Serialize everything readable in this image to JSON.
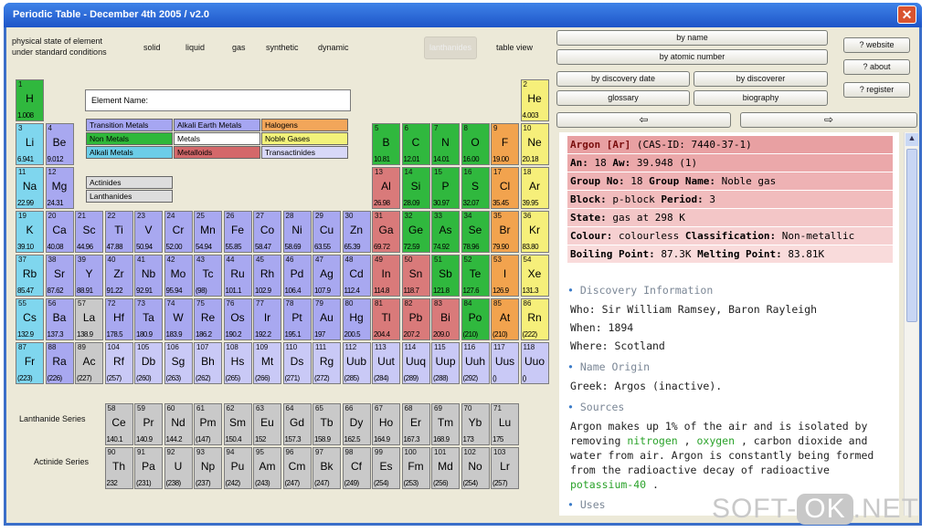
{
  "window": {
    "title": "Periodic Table - December 4th 2005 / v2.0",
    "close_glyph": "✕"
  },
  "toolbar": {
    "physical_state_label": "physical state of element\nunder standard conditions",
    "states": [
      "solid",
      "liquid",
      "gas",
      "synthetic",
      "dynamic"
    ],
    "disabled_button": "lanthanides",
    "table_view": "table view"
  },
  "sort_buttons": {
    "by_name": "by name",
    "by_atomic_number": "by atomic number",
    "by_discovery_date": "by discovery date",
    "by_discoverer": "by discoverer",
    "glossary": "glossary",
    "biography": "biography",
    "prev_arrow": "⇦",
    "next_arrow": "⇨",
    "website": "? website",
    "about": "? about",
    "register": "? register"
  },
  "element_name_label": "Element Name:",
  "legend": {
    "items": [
      "Transition Metals",
      "Alkali Earth Metals",
      "Halogens",
      "Non Metals",
      "Metals",
      "Noble Gases",
      "Alkali Metals",
      "Metalloids",
      "Transactinides"
    ],
    "colors": [
      "#a6a6f2",
      "#a6a6f2",
      "#f2a65a",
      "#2fb83a",
      "#ffffff",
      "#f2f27a",
      "#6ccde8",
      "#d4686a",
      "#d8d8f8"
    ],
    "actinides": "Actinides",
    "lanthanides": "Lanthanides"
  },
  "series_labels": {
    "lanthanide": "Lanthanide Series",
    "actinide": "Actinide Series"
  },
  "colors": {
    "alkali": "#7fd6ee",
    "alkaline": "#a8a8f0",
    "transition": "#a8a8f0",
    "nonmetal": "#30b83e",
    "halogen": "#f2a34e",
    "noble": "#f6ef7a",
    "metalloid": "#d97a7a",
    "metal": "#c9c9c9",
    "lanact": "#c9c9c9",
    "trans": "#c9c9f6",
    "hydrogen": "#30b83e"
  },
  "elements": [
    {
      "n": "1",
      "s": "H",
      "w": "1.008",
      "c": "hydrogen",
      "col": 1,
      "row": 1
    },
    {
      "n": "2",
      "s": "He",
      "w": "4.003",
      "c": "noble",
      "col": 18,
      "row": 1
    },
    {
      "n": "3",
      "s": "Li",
      "w": "6.941",
      "c": "alkali",
      "col": 1,
      "row": 2
    },
    {
      "n": "4",
      "s": "Be",
      "w": "9.012",
      "c": "alkaline",
      "col": 2,
      "row": 2
    },
    {
      "n": "5",
      "s": "B",
      "w": "10.81",
      "c": "nonmetal",
      "col": 13,
      "row": 2
    },
    {
      "n": "6",
      "s": "C",
      "w": "12.01",
      "c": "nonmetal",
      "col": 14,
      "row": 2
    },
    {
      "n": "7",
      "s": "N",
      "w": "14.01",
      "c": "nonmetal",
      "col": 15,
      "row": 2
    },
    {
      "n": "8",
      "s": "O",
      "w": "16.00",
      "c": "nonmetal",
      "col": 16,
      "row": 2
    },
    {
      "n": "9",
      "s": "F",
      "w": "19.00",
      "c": "halogen",
      "col": 17,
      "row": 2
    },
    {
      "n": "10",
      "s": "Ne",
      "w": "20.18",
      "c": "noble",
      "col": 18,
      "row": 2
    },
    {
      "n": "11",
      "s": "Na",
      "w": "22.99",
      "c": "alkali",
      "col": 1,
      "row": 3
    },
    {
      "n": "12",
      "s": "Mg",
      "w": "24.31",
      "c": "alkaline",
      "col": 2,
      "row": 3
    },
    {
      "n": "13",
      "s": "Al",
      "w": "26.98",
      "c": "metalloid",
      "col": 13,
      "row": 3
    },
    {
      "n": "14",
      "s": "Si",
      "w": "28.09",
      "c": "nonmetal",
      "col": 14,
      "row": 3
    },
    {
      "n": "15",
      "s": "P",
      "w": "30.97",
      "c": "nonmetal",
      "col": 15,
      "row": 3
    },
    {
      "n": "16",
      "s": "S",
      "w": "32.07",
      "c": "nonmetal",
      "col": 16,
      "row": 3
    },
    {
      "n": "17",
      "s": "Cl",
      "w": "35.45",
      "c": "halogen",
      "col": 17,
      "row": 3
    },
    {
      "n": "18",
      "s": "Ar",
      "w": "39.95",
      "c": "noble",
      "col": 18,
      "row": 3
    },
    {
      "n": "19",
      "s": "K",
      "w": "39.10",
      "c": "alkali",
      "col": 1,
      "row": 4
    },
    {
      "n": "20",
      "s": "Ca",
      "w": "40.08",
      "c": "alkaline",
      "col": 2,
      "row": 4
    },
    {
      "n": "21",
      "s": "Sc",
      "w": "44.96",
      "c": "transition",
      "col": 3,
      "row": 4
    },
    {
      "n": "22",
      "s": "Ti",
      "w": "47.88",
      "c": "transition",
      "col": 4,
      "row": 4
    },
    {
      "n": "23",
      "s": "V",
      "w": "50.94",
      "c": "transition",
      "col": 5,
      "row": 4
    },
    {
      "n": "24",
      "s": "Cr",
      "w": "52.00",
      "c": "transition",
      "col": 6,
      "row": 4
    },
    {
      "n": "25",
      "s": "Mn",
      "w": "54.94",
      "c": "transition",
      "col": 7,
      "row": 4
    },
    {
      "n": "26",
      "s": "Fe",
      "w": "55.85",
      "c": "transition",
      "col": 8,
      "row": 4
    },
    {
      "n": "27",
      "s": "Co",
      "w": "58.47",
      "c": "transition",
      "col": 9,
      "row": 4
    },
    {
      "n": "28",
      "s": "Ni",
      "w": "58.69",
      "c": "transition",
      "col": 10,
      "row": 4
    },
    {
      "n": "29",
      "s": "Cu",
      "w": "63.55",
      "c": "transition",
      "col": 11,
      "row": 4
    },
    {
      "n": "30",
      "s": "Zn",
      "w": "65.39",
      "c": "transition",
      "col": 12,
      "row": 4
    },
    {
      "n": "31",
      "s": "Ga",
      "w": "69.72",
      "c": "metalloid",
      "col": 13,
      "row": 4
    },
    {
      "n": "32",
      "s": "Ge",
      "w": "72.59",
      "c": "nonmetal",
      "col": 14,
      "row": 4
    },
    {
      "n": "33",
      "s": "As",
      "w": "74.92",
      "c": "nonmetal",
      "col": 15,
      "row": 4
    },
    {
      "n": "34",
      "s": "Se",
      "w": "78.96",
      "c": "nonmetal",
      "col": 16,
      "row": 4
    },
    {
      "n": "35",
      "s": "Br",
      "w": "79.90",
      "c": "halogen",
      "col": 17,
      "row": 4
    },
    {
      "n": "36",
      "s": "Kr",
      "w": "83.80",
      "c": "noble",
      "col": 18,
      "row": 4
    },
    {
      "n": "37",
      "s": "Rb",
      "w": "85.47",
      "c": "alkali",
      "col": 1,
      "row": 5
    },
    {
      "n": "38",
      "s": "Sr",
      "w": "87.62",
      "c": "alkaline",
      "col": 2,
      "row": 5
    },
    {
      "n": "39",
      "s": "Y",
      "w": "88.91",
      "c": "transition",
      "col": 3,
      "row": 5
    },
    {
      "n": "40",
      "s": "Zr",
      "w": "91.22",
      "c": "transition",
      "col": 4,
      "row": 5
    },
    {
      "n": "41",
      "s": "Nb",
      "w": "92.91",
      "c": "transition",
      "col": 5,
      "row": 5
    },
    {
      "n": "42",
      "s": "Mo",
      "w": "95.94",
      "c": "transition",
      "col": 6,
      "row": 5
    },
    {
      "n": "43",
      "s": "Tc",
      "w": "(98)",
      "c": "transition",
      "col": 7,
      "row": 5
    },
    {
      "n": "44",
      "s": "Ru",
      "w": "101.1",
      "c": "transition",
      "col": 8,
      "row": 5
    },
    {
      "n": "45",
      "s": "Rh",
      "w": "102.9",
      "c": "transition",
      "col": 9,
      "row": 5
    },
    {
      "n": "46",
      "s": "Pd",
      "w": "106.4",
      "c": "transition",
      "col": 10,
      "row": 5
    },
    {
      "n": "47",
      "s": "Ag",
      "w": "107.9",
      "c": "transition",
      "col": 11,
      "row": 5
    },
    {
      "n": "48",
      "s": "Cd",
      "w": "112.4",
      "c": "transition",
      "col": 12,
      "row": 5
    },
    {
      "n": "49",
      "s": "In",
      "w": "114.8",
      "c": "metalloid",
      "col": 13,
      "row": 5
    },
    {
      "n": "50",
      "s": "Sn",
      "w": "118.7",
      "c": "metalloid",
      "col": 14,
      "row": 5
    },
    {
      "n": "51",
      "s": "Sb",
      "w": "121.8",
      "c": "nonmetal",
      "col": 15,
      "row": 5
    },
    {
      "n": "52",
      "s": "Te",
      "w": "127.6",
      "c": "nonmetal",
      "col": 16,
      "row": 5
    },
    {
      "n": "53",
      "s": "I",
      "w": "126.9",
      "c": "halogen",
      "col": 17,
      "row": 5
    },
    {
      "n": "54",
      "s": "Xe",
      "w": "131.3",
      "c": "noble",
      "col": 18,
      "row": 5
    },
    {
      "n": "55",
      "s": "Cs",
      "w": "132.9",
      "c": "alkali",
      "col": 1,
      "row": 6
    },
    {
      "n": "56",
      "s": "Ba",
      "w": "137.3",
      "c": "alkaline",
      "col": 2,
      "row": 6
    },
    {
      "n": "57",
      "s": "La",
      "w": "138.9",
      "c": "lanact",
      "col": 3,
      "row": 6
    },
    {
      "n": "72",
      "s": "Hf",
      "w": "178.5",
      "c": "transition",
      "col": 4,
      "row": 6
    },
    {
      "n": "73",
      "s": "Ta",
      "w": "180.9",
      "c": "transition",
      "col": 5,
      "row": 6
    },
    {
      "n": "74",
      "s": "W",
      "w": "183.9",
      "c": "transition",
      "col": 6,
      "row": 6
    },
    {
      "n": "75",
      "s": "Re",
      "w": "186.2",
      "c": "transition",
      "col": 7,
      "row": 6
    },
    {
      "n": "76",
      "s": "Os",
      "w": "190.2",
      "c": "transition",
      "col": 8,
      "row": 6
    },
    {
      "n": "77",
      "s": "Ir",
      "w": "192.2",
      "c": "transition",
      "col": 9,
      "row": 6
    },
    {
      "n": "78",
      "s": "Pt",
      "w": "195.1",
      "c": "transition",
      "col": 10,
      "row": 6
    },
    {
      "n": "79",
      "s": "Au",
      "w": "197",
      "c": "transition",
      "col": 11,
      "row": 6
    },
    {
      "n": "80",
      "s": "Hg",
      "w": "200.5",
      "c": "transition",
      "col": 12,
      "row": 6
    },
    {
      "n": "81",
      "s": "Tl",
      "w": "204.4",
      "c": "metalloid",
      "col": 13,
      "row": 6
    },
    {
      "n": "82",
      "s": "Pb",
      "w": "207.2",
      "c": "metalloid",
      "col": 14,
      "row": 6
    },
    {
      "n": "83",
      "s": "Bi",
      "w": "209.0",
      "c": "metalloid",
      "col": 15,
      "row": 6
    },
    {
      "n": "84",
      "s": "Po",
      "w": "(210)",
      "c": "nonmetal",
      "col": 16,
      "row": 6
    },
    {
      "n": "85",
      "s": "At",
      "w": "(210)",
      "c": "halogen",
      "col": 17,
      "row": 6
    },
    {
      "n": "86",
      "s": "Rn",
      "w": "(222)",
      "c": "noble",
      "col": 18,
      "row": 6
    },
    {
      "n": "87",
      "s": "Fr",
      "w": "(223)",
      "c": "alkali",
      "col": 1,
      "row": 7
    },
    {
      "n": "88",
      "s": "Ra",
      "w": "(226)",
      "c": "alkaline",
      "col": 2,
      "row": 7
    },
    {
      "n": "89",
      "s": "Ac",
      "w": "(227)",
      "c": "lanact",
      "col": 3,
      "row": 7
    },
    {
      "n": "104",
      "s": "Rf",
      "w": "(257)",
      "c": "trans",
      "col": 4,
      "row": 7
    },
    {
      "n": "105",
      "s": "Db",
      "w": "(260)",
      "c": "trans",
      "col": 5,
      "row": 7
    },
    {
      "n": "106",
      "s": "Sg",
      "w": "(263)",
      "c": "trans",
      "col": 6,
      "row": 7
    },
    {
      "n": "107",
      "s": "Bh",
      "w": "(262)",
      "c": "trans",
      "col": 7,
      "row": 7
    },
    {
      "n": "108",
      "s": "Hs",
      "w": "(265)",
      "c": "trans",
      "col": 8,
      "row": 7
    },
    {
      "n": "109",
      "s": "Mt",
      "w": "(266)",
      "c": "trans",
      "col": 9,
      "row": 7
    },
    {
      "n": "110",
      "s": "Ds",
      "w": "(271)",
      "c": "trans",
      "col": 10,
      "row": 7
    },
    {
      "n": "111",
      "s": "Rg",
      "w": "(272)",
      "c": "trans",
      "col": 11,
      "row": 7
    },
    {
      "n": "112",
      "s": "Uub",
      "w": "(285)",
      "c": "trans",
      "col": 12,
      "row": 7
    },
    {
      "n": "113",
      "s": "Uut",
      "w": "(284)",
      "c": "trans",
      "col": 13,
      "row": 7
    },
    {
      "n": "114",
      "s": "Uuq",
      "w": "(289)",
      "c": "trans",
      "col": 14,
      "row": 7
    },
    {
      "n": "115",
      "s": "Uup",
      "w": "(288)",
      "c": "trans",
      "col": 15,
      "row": 7
    },
    {
      "n": "116",
      "s": "Uuh",
      "w": "(292)",
      "c": "trans",
      "col": 16,
      "row": 7
    },
    {
      "n": "117",
      "s": "Uus",
      "w": "()",
      "c": "trans",
      "col": 17,
      "row": 7
    },
    {
      "n": "118",
      "s": "Uuo",
      "w": "()",
      "c": "trans",
      "col": 18,
      "row": 7
    }
  ],
  "lanthanides": [
    {
      "n": "58",
      "s": "Ce",
      "w": "140.1"
    },
    {
      "n": "59",
      "s": "Pr",
      "w": "140.9"
    },
    {
      "n": "60",
      "s": "Nd",
      "w": "144.2"
    },
    {
      "n": "61",
      "s": "Pm",
      "w": "(147)"
    },
    {
      "n": "62",
      "s": "Sm",
      "w": "150.4"
    },
    {
      "n": "63",
      "s": "Eu",
      "w": "152"
    },
    {
      "n": "64",
      "s": "Gd",
      "w": "157.3"
    },
    {
      "n": "65",
      "s": "Tb",
      "w": "158.9"
    },
    {
      "n": "66",
      "s": "Dy",
      "w": "162.5"
    },
    {
      "n": "67",
      "s": "Ho",
      "w": "164.9"
    },
    {
      "n": "68",
      "s": "Er",
      "w": "167.3"
    },
    {
      "n": "69",
      "s": "Tm",
      "w": "168.9"
    },
    {
      "n": "70",
      "s": "Yb",
      "w": "173"
    },
    {
      "n": "71",
      "s": "Lu",
      "w": "175"
    }
  ],
  "actinides": [
    {
      "n": "90",
      "s": "Th",
      "w": "232"
    },
    {
      "n": "91",
      "s": "Pa",
      "w": "(231)"
    },
    {
      "n": "92",
      "s": "U",
      "w": "(238)"
    },
    {
      "n": "93",
      "s": "Np",
      "w": "(237)"
    },
    {
      "n": "94",
      "s": "Pu",
      "w": "(242)"
    },
    {
      "n": "95",
      "s": "Am",
      "w": "(243)"
    },
    {
      "n": "96",
      "s": "Cm",
      "w": "(247)"
    },
    {
      "n": "97",
      "s": "Bk",
      "w": "(247)"
    },
    {
      "n": "98",
      "s": "Cf",
      "w": "(249)"
    },
    {
      "n": "99",
      "s": "Es",
      "w": "(254)"
    },
    {
      "n": "100",
      "s": "Fm",
      "w": "(253)"
    },
    {
      "n": "101",
      "s": "Md",
      "w": "(256)"
    },
    {
      "n": "102",
      "s": "No",
      "w": "(254)"
    },
    {
      "n": "103",
      "s": "Lr",
      "w": "(257)"
    }
  ],
  "info": {
    "rows": [
      {
        "label": "Argon [Ar]",
        "value": " (CAS-ID: 7440-37-1)",
        "bg": "#e8a0a2"
      },
      {
        "label": "An:",
        "value": " 18 ",
        "label2": "Aw:",
        "value2": " 39.948 (1)",
        "bg": "#eba8aa"
      },
      {
        "label": "Group No:",
        "value": " 18 ",
        "label2": "Group Name:",
        "value2": " Noble gas",
        "bg": "#eeb2b4"
      },
      {
        "label": "Block:",
        "value": " p-block ",
        "label2": "Period:",
        "value2": " 3",
        "bg": "#f1bcbd"
      },
      {
        "label": "State:",
        "value": " gas at 298 K",
        "bg": "#f3c6c7"
      },
      {
        "label": "Colour:",
        "value": " colourless ",
        "label2": "Classification:",
        "value2": " Non-metallic",
        "bg": "#f6d0d1"
      },
      {
        "label": "Boiling Point:",
        "value": " 87.3K ",
        "label2": "Melting Point:",
        "value2": " 83.81K",
        "bg": "#f9dbdb"
      }
    ],
    "discovery_title": "Discovery Information",
    "who": "Who: Sir William Ramsey, Baron Rayleigh",
    "when": "When: 1894",
    "where": "Where: Scotland",
    "name_origin_title": "Name Origin",
    "greek": "Greek: Argos (inactive).",
    "sources_title": "Sources",
    "sources_1": "Argon makes up 1% of the air and is isolated by",
    "sources_2a": "removing ",
    "sources_2_link1": "nitrogen",
    "sources_2b": " , ",
    "sources_2_link2": "oxygen",
    "sources_2c": " , carbon dioxide and",
    "sources_3": "water from air. Argon is constantly being formed",
    "sources_4": "from the radioactive decay of radioactive",
    "sources_5_link": "potassium-40",
    "sources_5b": " .",
    "uses_title": "Uses"
  },
  "watermark": {
    "a": "SOFT-",
    "b": "OK",
    "c": ".NET"
  }
}
